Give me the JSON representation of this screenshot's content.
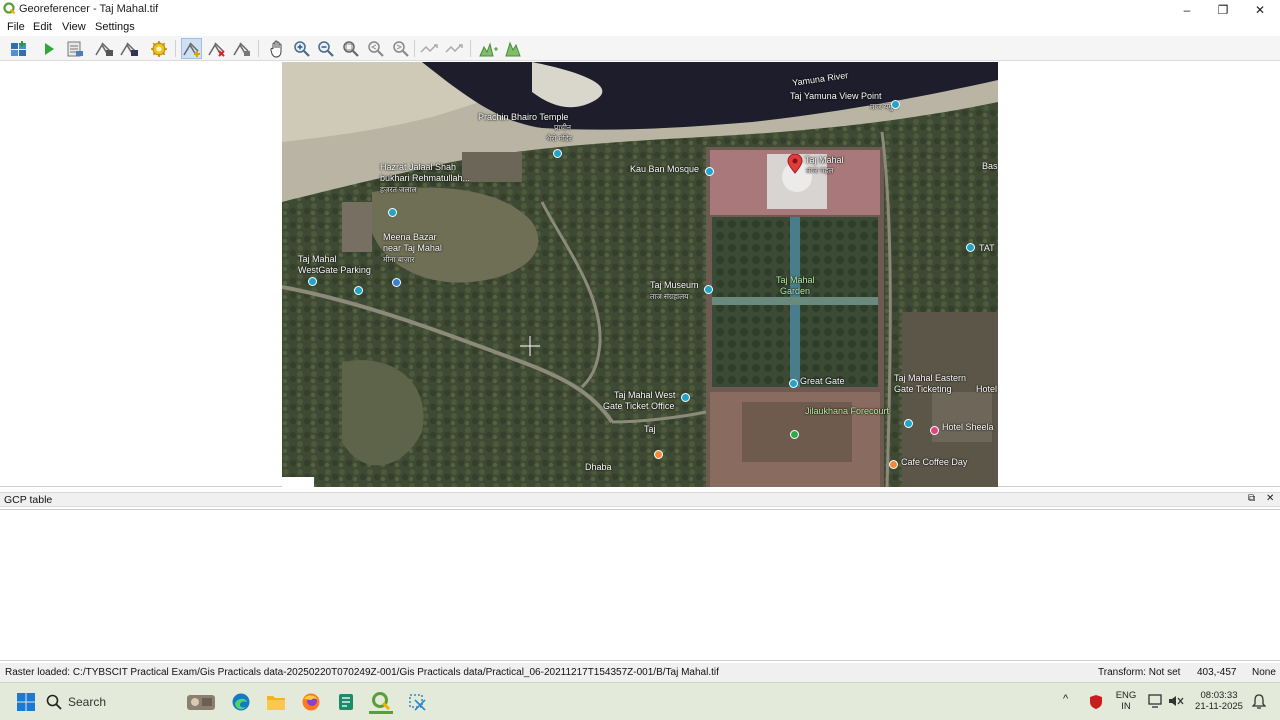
{
  "window": {
    "title": "Georeferencer - Taj Mahal.tif",
    "minimize_glyph": "–",
    "maximize_glyph": "❐",
    "close_glyph": "✕"
  },
  "menu": {
    "file": "File",
    "edit": "Edit",
    "view": "View",
    "settings": "Settings"
  },
  "toolbar": {
    "icons": [
      "open-raster-icon",
      "start-georeferencing-icon",
      "generate-gdal-script-icon",
      "load-gcp-points-icon",
      "save-gcp-points-icon",
      "transformation-settings-icon",
      "add-point-icon",
      "delete-point-icon",
      "move-gcp-point-icon",
      "pan-icon",
      "zoom-in-icon",
      "zoom-out-icon",
      "zoom-to-layer-icon",
      "zoom-last-icon",
      "zoom-next-icon",
      "link-georeferencer-to-qgis-icon",
      "link-qgis-to-georeferencer-icon",
      "full-histogram-stretch-icon",
      "local-histogram-stretch-icon"
    ]
  },
  "map": {
    "labels": {
      "yamuna_river": "Yamuna River",
      "yamuna_view_point": "Taj Yamuna View Point",
      "yamuna_view_point_hindi": "ताज यमुना",
      "prachin_bhairo": "Prachin Bhairo Temple",
      "prachin_bhairo_hindi1": "प्राचीन",
      "prachin_bhairo_hindi2": "भैरो मंदिर",
      "hazrat_1": "Hazrat Jalaal Shah",
      "hazrat_2": "bukhari Rehmatullah...",
      "hazrat_hindi": "हज़रत जलाल",
      "kau_ban": "Kau Ban Mosque",
      "taj_mahal": "Taj Mahal",
      "taj_mahal_hindi": "ताज महल",
      "meena_bazar_1": "Meena Bazar",
      "meena_bazar_2": "near Taj Mahal",
      "meena_bazar_hindi": "मीना बाज़ार",
      "west_gate_parking_1": "Taj Mahal",
      "west_gate_parking_2": "WestGate Parking",
      "taj_museum": "Taj Museum",
      "taj_museum_hindi": "ताज संग्रहालय",
      "taj_garden_1": "Taj Mahal",
      "taj_garden_2": "Garden",
      "great_gate": "Great Gate",
      "west_ticket_1": "Taj Mahal West",
      "west_ticket_2": "Gate Ticket Office",
      "jilaukhana": "Jilaukhana Forecourt",
      "eastern_ticket_1": "Taj Mahal Eastern",
      "eastern_ticket_2": "Gate Ticketing",
      "hotel": "Hotel",
      "hotel_sheela": "Hotel Sheela",
      "cafe_coffee_day": "Cafe Coffee Day",
      "dhaba": "Dhaba",
      "taj_small": "Taj",
      "bas": "Bas",
      "tat": "TAT"
    }
  },
  "gcp_panel": {
    "title": "GCP table",
    "float_glyph": "⧉",
    "close_glyph": "✕"
  },
  "status": {
    "raster_loaded": "Raster loaded: C:/TYBSCIT Practical Exam/Gis Practicals data-20250220T070249Z-001/Gis Practicals data/Practical_06-20211217T154357Z-001/B/Taj Mahal.tif",
    "transform": "Transform: Not set",
    "coords": "403,-457",
    "crs": "None"
  },
  "taskbar": {
    "search_label": "Search",
    "icons": [
      "windows-start-icon",
      "search-icon",
      "widgets-icon",
      "edge-icon",
      "file-explorer-icon",
      "firefox-icon",
      "store-icon",
      "qgis-icon",
      "snipping-tool-icon"
    ],
    "tray": {
      "lang_1": "ENG",
      "lang_2": "IN",
      "time": "08:03:33",
      "date": "21-11-2025"
    }
  },
  "colors": {
    "active_tool_bg": "#cfe0f5",
    "taskbar_bg": "#e3ead9",
    "qgis_green": "#5a9e3a"
  }
}
